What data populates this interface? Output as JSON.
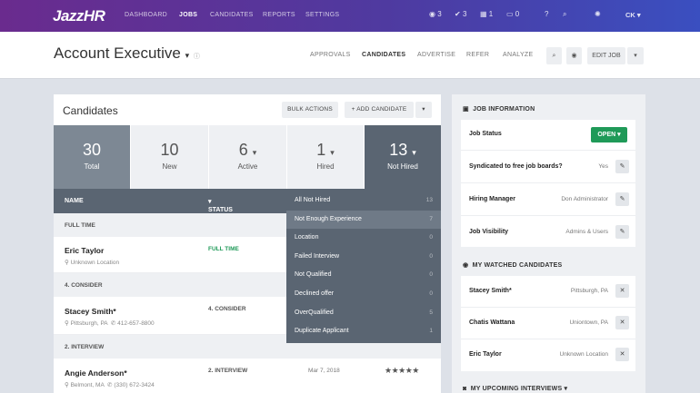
{
  "nav": {
    "logo": "JazzHR",
    "links": [
      "DASHBOARD",
      "JOBS",
      "CANDIDATES",
      "REPORTS",
      "SETTINGS"
    ],
    "watch_count": "3",
    "check_count": "3",
    "cal_count": "1",
    "inbox_count": "0",
    "user": "CK"
  },
  "sub": {
    "job_title": "Account Executive",
    "tabs": [
      "APPROVALS",
      "CANDIDATES",
      "ADVERTISE",
      "REFER",
      "ANALYZE"
    ],
    "edit_job": "EDIT JOB"
  },
  "candidates": {
    "title": "Candidates",
    "bulk_actions": "BULK ACTIONS",
    "add_candidate": "+ ADD CANDIDATE",
    "stats": [
      {
        "num": "30",
        "label": "Total"
      },
      {
        "num": "10",
        "label": "New"
      },
      {
        "num": "6",
        "label": "Active"
      },
      {
        "num": "1",
        "label": "Hired"
      },
      {
        "num": "13",
        "label": "Not Hired"
      }
    ],
    "col_name": "NAME",
    "col_status": "STATUS",
    "groups": [
      "FULL TIME",
      "4. CONSIDER",
      "2. INTERVIEW"
    ],
    "rows": [
      {
        "name": "Eric Taylor",
        "loc": "Unknown Location",
        "status": "FULL TIME"
      },
      {
        "name": "Stacey Smith*",
        "loc": "Pittsburgh, PA",
        "phone": "412-657-8800",
        "status": "4. CONSIDER"
      },
      {
        "name": "Angie Anderson*",
        "loc": "Belmont, MA",
        "phone": "(330) 672-3424",
        "status": "2. INTERVIEW",
        "date": "Mar 7, 2018",
        "stars": "★★★★★",
        "rating": 5
      }
    ],
    "dropdown": [
      {
        "label": "All Not Hired",
        "count": "13"
      },
      {
        "label": "Not Enough Experience",
        "count": "7"
      },
      {
        "label": "Location",
        "count": "0"
      },
      {
        "label": "Failed Interview",
        "count": "0"
      },
      {
        "label": "Not Qualified",
        "count": "0"
      },
      {
        "label": "Declined offer",
        "count": "0"
      },
      {
        "label": "OverQualified",
        "count": "5"
      },
      {
        "label": "Duplicate Applicant",
        "count": "1"
      }
    ]
  },
  "job_info": {
    "title": "JOB INFORMATION",
    "status_label": "Job Status",
    "status_value": "OPEN",
    "synd_label": "Syndicated to free job boards?",
    "synd_value": "Yes",
    "hm_label": "Hiring Manager",
    "hm_value": "Don Administrator",
    "vis_label": "Job Visibility",
    "vis_value": "Admins & Users"
  },
  "watched": {
    "title": "MY WATCHED CANDIDATES",
    "items": [
      {
        "name": "Stacey Smith*",
        "loc": "Pittsburgh, PA"
      },
      {
        "name": "Chatis Wattana",
        "loc": "Uniontown, PA"
      },
      {
        "name": "Eric Taylor",
        "loc": "Unknown Location"
      }
    ]
  },
  "interviews": {
    "title": "MY UPCOMING INTERVIEWS"
  },
  "colors": {
    "nav_start": "#6a2b8e",
    "nav_end": "#3a4fc0",
    "open": "#1f9a58",
    "header": "#5a6572",
    "full_time": "#1f9a58"
  },
  "dropdown_highlight": "Not Enough Experience"
}
